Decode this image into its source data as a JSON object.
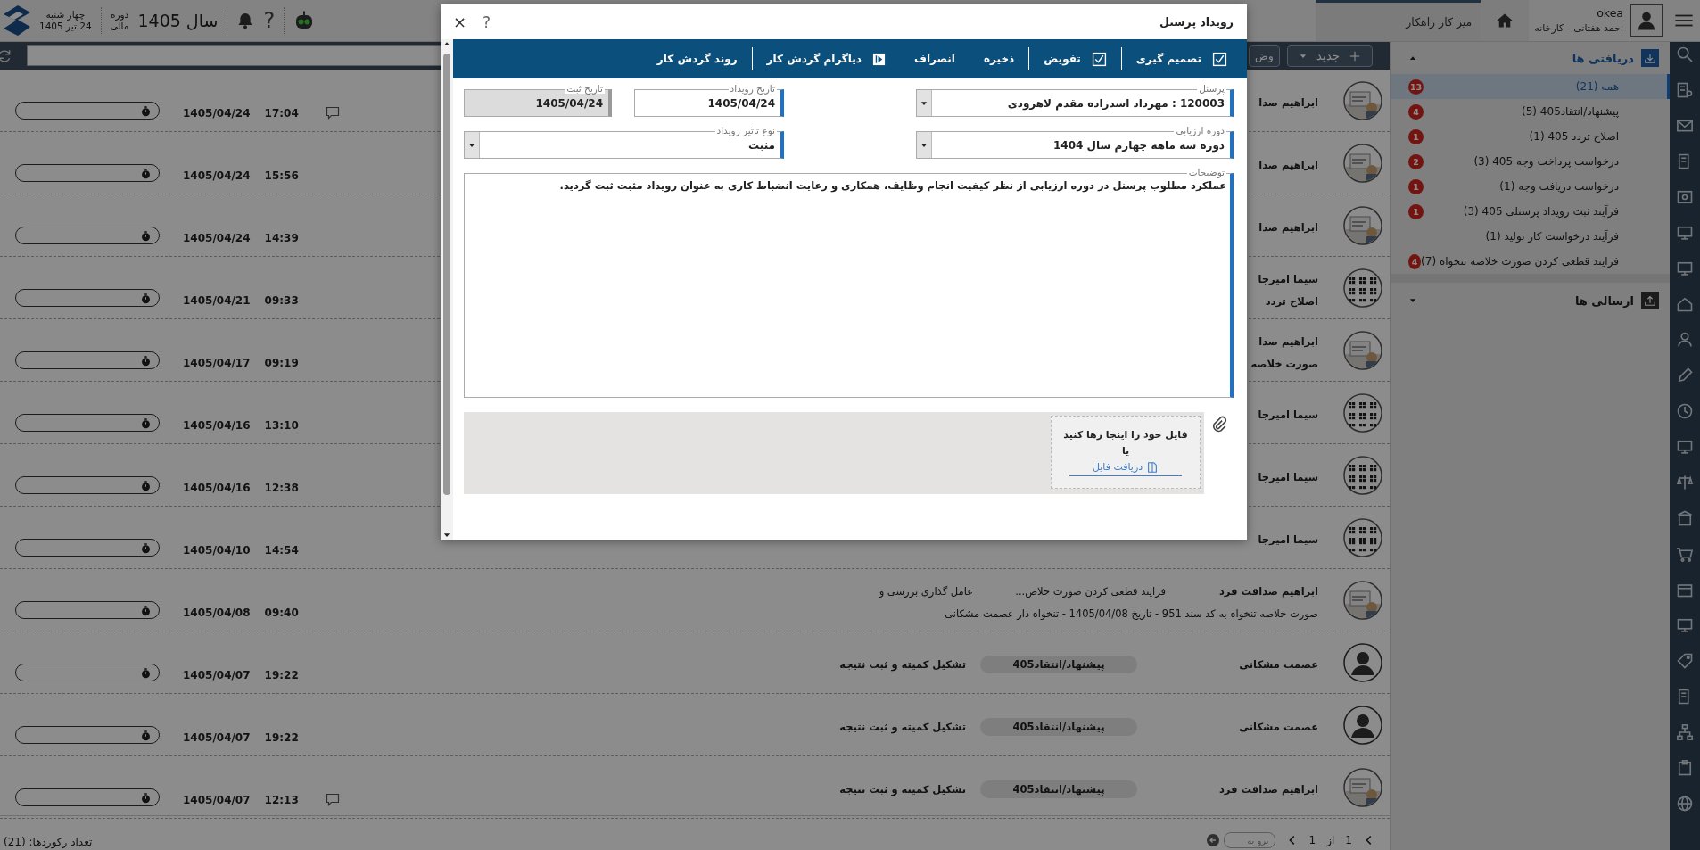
{
  "header": {
    "user_name": "okea",
    "user_subtitle": "احمد هفتانی - کارخانه",
    "workspace_tab": "میز کار راهکار",
    "fiscal_label_1": "دوره",
    "fiscal_label_2": "مالی",
    "fiscal_year": "سال 1405",
    "weekday": "چهار شنبه",
    "date": "24 تیر 1405",
    "help": "?"
  },
  "toolbar": {
    "new_button": "جدید",
    "partial_button": "وض"
  },
  "sidebar": {
    "sections": [
      {
        "title": "دریافتی ها",
        "kind": "inbox",
        "expanded": true,
        "items": [
          {
            "label": "همه (21)",
            "badge": "13",
            "selected": true
          },
          {
            "label": "پیشنهاد/انتقاد405 (5)",
            "badge": "4",
            "selected": false
          },
          {
            "label": "اصلاح تردد 405 (1)",
            "badge": "1",
            "selected": false
          },
          {
            "label": "درخواست پرداخت وجه 405 (3)",
            "badge": "2",
            "selected": false
          },
          {
            "label": "درخواست دریافت وجه (1)",
            "badge": "1",
            "selected": false
          },
          {
            "label": "فرآیند ثبت رویداد پرسنلی 405 (3)",
            "badge": "1",
            "selected": false
          },
          {
            "label": "فرآیند درخواست کار تولید (1)",
            "selected": false
          },
          {
            "label": "فرایند قطعی کردن صورت خلاصه تنخواه (7)",
            "badge": "4",
            "selected": false
          }
        ]
      },
      {
        "title": "ارسالی ها",
        "kind": "outbox",
        "expanded": false
      }
    ]
  },
  "rows": [
    {
      "time": "17:04",
      "date": "1405/04/24",
      "has_comment": true,
      "kind": "picture",
      "name": "ابراهیم صدا"
    },
    {
      "time": "15:56",
      "date": "1405/04/24",
      "has_comment": false,
      "kind": "picture",
      "name": "ابراهیم صدا"
    },
    {
      "time": "14:39",
      "date": "1405/04/24",
      "has_comment": false,
      "kind": "picture",
      "name": "ابراهیم صدا"
    },
    {
      "time": "09:33",
      "date": "1405/04/21",
      "has_comment": false,
      "kind": "pattern",
      "name": "سیما امیرجا",
      "subtitle": "اصلاح تردد"
    },
    {
      "time": "09:19",
      "date": "1405/04/17",
      "has_comment": false,
      "kind": "picture",
      "name": "ابراهیم صدا",
      "subtitle": "صورت خلاصه"
    },
    {
      "time": "13:10",
      "date": "1405/04/16",
      "has_comment": false,
      "kind": "pattern",
      "name": "سیما امیرجا"
    },
    {
      "time": "12:38",
      "date": "1405/04/16",
      "has_comment": false,
      "kind": "pattern",
      "name": "سیما امیرجا"
    },
    {
      "time": "14:54",
      "date": "1405/04/10",
      "has_comment": false,
      "kind": "pattern",
      "name": "سیما امیرجا"
    },
    {
      "time": "09:40",
      "date": "1405/04/08",
      "has_comment": false,
      "kind": "picture",
      "name": "ابراهیم صداقت فرد",
      "process": "فرایند قطعی کردن صورت خلاص...",
      "step": "عامل گذاری بررسی و",
      "subtitle": "صورت خلاصه تنخواه به کد سند 951 - تاریخ 1405/04/08 - تنخواه دار عصمت مشکانی"
    },
    {
      "time": "19:22",
      "date": "1405/04/07",
      "has_comment": false,
      "kind": "person",
      "name": "عصمت مشکانی",
      "tag": "پیشنهاد/انتقاد405",
      "step": "تشکیل کمیته و ثبت نتیجه"
    },
    {
      "time": "19:22",
      "date": "1405/04/07",
      "has_comment": false,
      "kind": "person",
      "name": "عصمت مشکانی",
      "tag": "پیشنهاد/انتقاد405",
      "step": "تشکیل کمیته و ثبت نتیجه"
    },
    {
      "time": "12:13",
      "date": "1405/04/07",
      "has_comment": true,
      "kind": "picture",
      "name": "ابراهیم صداقت فرد",
      "tag": "پیشنهاد/انتقاد405",
      "step": "تشکیل کمیته و ثبت نتیجه"
    }
  ],
  "footer": {
    "record_count": "تعداد رکوردها: (21)",
    "page": "1",
    "of": "از",
    "total": "1",
    "goto_placeholder": "برو به"
  },
  "dialog": {
    "title": "رویداد پرسنل",
    "help": "?",
    "close": "×",
    "actions": [
      {
        "label": "تصمیم گیری",
        "kind": "check",
        "divider_after": true
      },
      {
        "label": "تفویض",
        "kind": "check",
        "divider_after": true
      },
      {
        "label": "ذخیره",
        "kind": "plain",
        "divider_after": false
      },
      {
        "label": "انصراف",
        "kind": "plain",
        "divider_after": false
      },
      {
        "label": "دیاگرام گردش کار",
        "kind": "play",
        "divider_after": true
      },
      {
        "label": "روند گردش کار",
        "kind": "plain",
        "divider_after": false
      }
    ],
    "fields": [
      {
        "label": "پرسنل",
        "value": "120003 : مهرداد اسدزاده مقدم لاهرودی",
        "kind": "select",
        "disabled": false
      },
      {
        "label": "تاریخ رویداد",
        "value": "1405/04/24",
        "kind": "text",
        "disabled": false
      },
      {
        "label": "تاریخ ثبت",
        "value": "1405/04/24",
        "kind": "text",
        "disabled": true
      },
      {
        "label": "دوره ارزیابی",
        "value": "دوره سه ماهه چهارم سال 1404",
        "kind": "select",
        "disabled": false
      },
      {
        "label": "نوع تاثیر رویداد",
        "value": "مثبت",
        "kind": "select",
        "disabled": false
      }
    ],
    "description": {
      "label": "توضیحات",
      "value": "عملکرد مطلوب پرسنل در دوره ارزیابی از نظر کیفیت انجام وظایف، همکاری و رعایت انضباط کاری به عنوان رویداد مثبت ثبت گردید."
    },
    "attachment": {
      "drop_text": "فایل خود را اینجا رها کنید",
      "or": "یا",
      "link": "دریافت فایل"
    }
  }
}
